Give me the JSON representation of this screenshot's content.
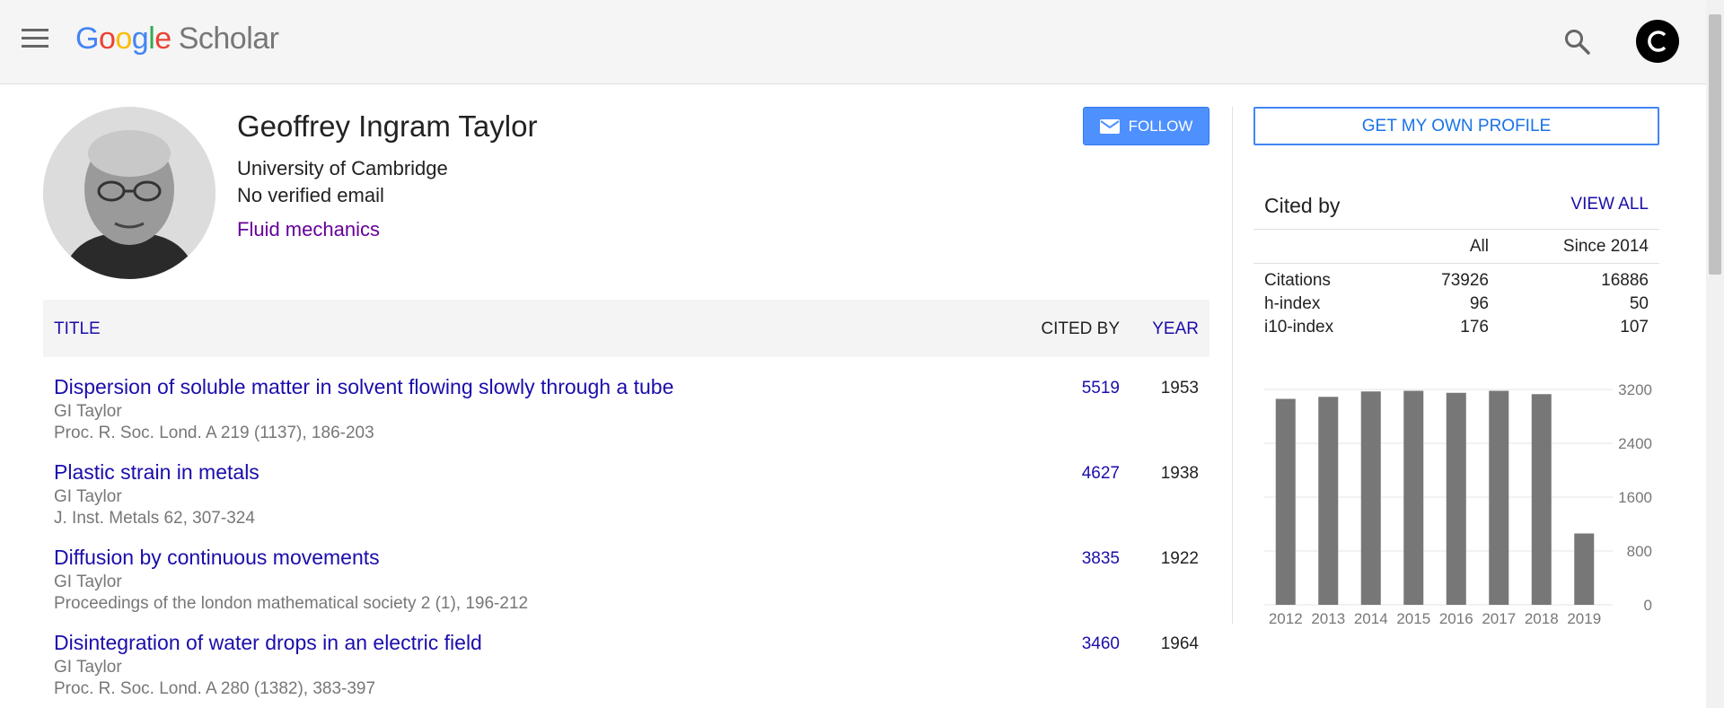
{
  "header": {
    "logo": {
      "letters": [
        "G",
        "o",
        "o",
        "g",
        "l",
        "e"
      ],
      "product": "Scholar"
    }
  },
  "profile": {
    "name": "Geoffrey Ingram Taylor",
    "affiliation": "University of Cambridge",
    "email": "No verified email",
    "interest": "Fluid mechanics",
    "follow_label": "FOLLOW"
  },
  "table": {
    "headers": {
      "title": "TITLE",
      "cited_by": "CITED BY",
      "year": "YEAR"
    },
    "articles": [
      {
        "title": "Dispersion of soluble matter in solvent flowing slowly through a tube",
        "authors": "GI Taylor",
        "venue": "Proc. R. Soc. Lond. A 219 (1137), 186-203",
        "cited_by": "5519",
        "year": "1953"
      },
      {
        "title": "Plastic strain in metals",
        "authors": "GI Taylor",
        "venue": "J. Inst. Metals 62, 307-324",
        "cited_by": "4627",
        "year": "1938"
      },
      {
        "title": "Diffusion by continuous movements",
        "authors": "GI Taylor",
        "venue": "Proceedings of the london mathematical society 2 (1), 196-212",
        "cited_by": "3835",
        "year": "1922"
      },
      {
        "title": "Disintegration of water drops in an electric field",
        "authors": "GI Taylor",
        "venue": "Proc. R. Soc. Lond. A 280 (1382), 383-397",
        "cited_by": "3460",
        "year": "1964"
      }
    ]
  },
  "sidebar": {
    "own_profile_label": "GET MY OWN PROFILE",
    "cited_by_title": "Cited by",
    "view_all_label": "VIEW ALL",
    "stats": {
      "col_all": "All",
      "col_since": "Since 2014",
      "rows": [
        {
          "label": "Citations",
          "all": "73926",
          "since": "16886"
        },
        {
          "label": "h-index",
          "all": "96",
          "since": "50"
        },
        {
          "label": "i10-index",
          "all": "176",
          "since": "107"
        }
      ]
    }
  },
  "chart_data": {
    "type": "bar",
    "categories": [
      "2012",
      "2013",
      "2014",
      "2015",
      "2016",
      "2017",
      "2018",
      "2019"
    ],
    "values": [
      3060,
      3090,
      3170,
      3180,
      3150,
      3180,
      3130,
      1060
    ],
    "yticks": [
      0,
      800,
      1600,
      2400,
      3200
    ],
    "ylim": [
      0,
      3200
    ],
    "bar_color": "#777777",
    "grid": true
  }
}
